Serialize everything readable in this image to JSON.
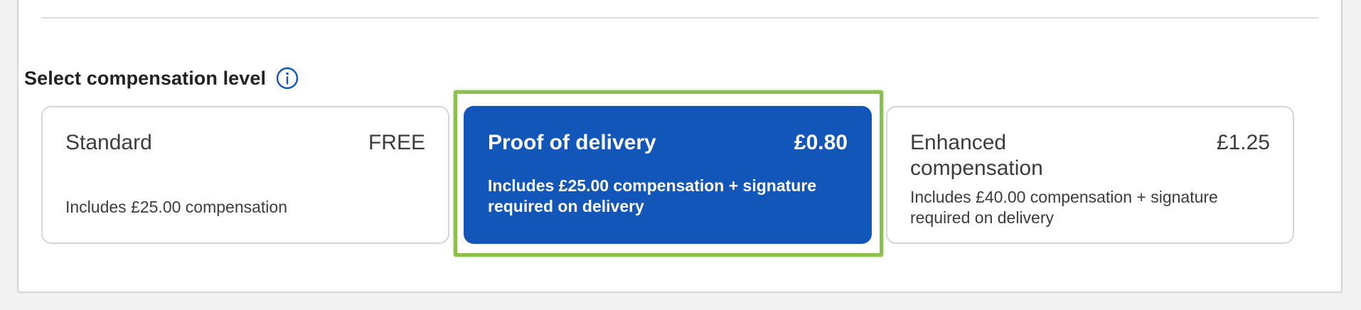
{
  "section": {
    "title": "Select compensation level",
    "info_icon": "info-circle-icon"
  },
  "options": [
    {
      "name": "Standard",
      "price": "FREE",
      "description": "Includes £25.00 compensation",
      "selected": false
    },
    {
      "name": "Proof of delivery",
      "price": "£0.80",
      "description": "Includes £25.00 compensation + signature required on delivery",
      "selected": true
    },
    {
      "name": "Enhanced compensation",
      "price": "£1.25",
      "description": "Includes £40.00 compensation + signature required on delivery",
      "selected": false
    }
  ],
  "colors": {
    "accent": "#1156b8",
    "highlight": "#8cc04c",
    "card_border": "#d6d6d6"
  }
}
